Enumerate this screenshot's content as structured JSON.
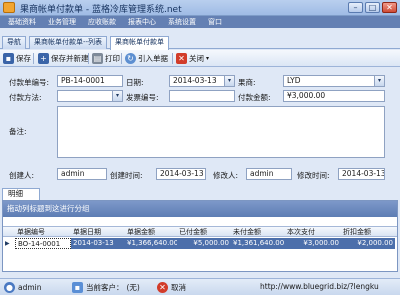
{
  "window": {
    "title": "果商帐单付款单 - 蓝格冷库管理系统.net",
    "controls": [
      "minimize",
      "maximize",
      "close"
    ]
  },
  "menu": {
    "items": [
      "基础资料",
      "业务管理",
      "应收账款",
      "报表中心",
      "系统设置",
      "窗口"
    ]
  },
  "tabs": [
    {
      "label": "导航"
    },
    {
      "label": "果商帐单付款单--列表"
    },
    {
      "label": "果商帐单付款单",
      "active": true
    }
  ],
  "toolbar": {
    "save": "保存",
    "save_new": "保存并新建",
    "print": "打印",
    "import": "引入单据",
    "close": "关闭"
  },
  "form": {
    "payment_no_label": "付款单编号:",
    "payment_no": "PB-14-0001",
    "date_label": "日期:",
    "date": "2014-03-13",
    "merchant_label": "果商:",
    "merchant": "LYD",
    "method_label": "付款方法:",
    "method": "",
    "invoice_no_label": "发票编号:",
    "invoice_no": "",
    "amount_label": "付款金额:",
    "amount": "¥3,000.00",
    "notes_label": "备注:",
    "notes": "",
    "creator_label": "创建人:",
    "creator": "admin",
    "created_time_label": "创建时间:",
    "created_time": "2014-03-13",
    "modifier_label": "修改人:",
    "modifier": "admin",
    "modified_time_label": "修改时间:",
    "modified_time": "2014-03-13"
  },
  "detail": {
    "tab_label": "明细",
    "group_hint": "拖动列标题到这进行分组",
    "columns": [
      "单据编号",
      "单据日期",
      "单据金额",
      "已付金额",
      "未付金额",
      "本次支付",
      "折扣金额"
    ],
    "rows": [
      [
        "BO-14-0001",
        "2014-03-13",
        "¥1,366,640.00",
        "¥5,000.00",
        "¥1,361,640.00",
        "¥3,000.00",
        "¥2,000.00"
      ]
    ]
  },
  "status": {
    "user": "admin",
    "customer_label": "当前客户：",
    "customer": "(无)",
    "cancel": "取消",
    "url": "http://www.bluegrid.biz/?lengku"
  },
  "colors": {
    "accent": "#4c6fab",
    "menu": "#6480b3",
    "background": "#dfe8f6"
  }
}
